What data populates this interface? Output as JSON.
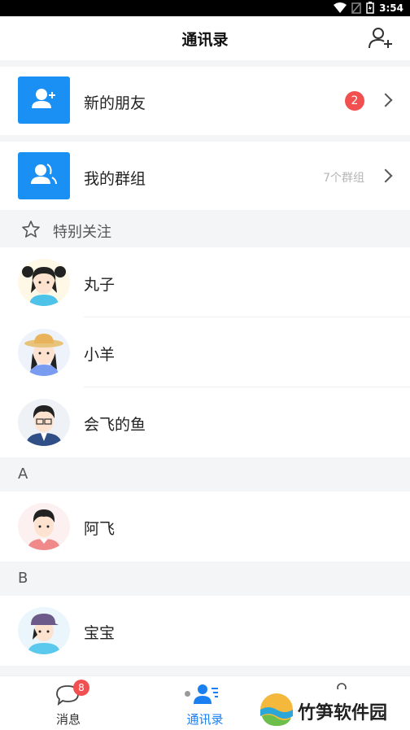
{
  "status": {
    "time": "3:54"
  },
  "header": {
    "title": "通讯录"
  },
  "top_rows": [
    {
      "label": "新的朋友",
      "badge": "2"
    },
    {
      "label": "我的群组",
      "count": "7个群组"
    }
  ],
  "special": {
    "title": "特别关注"
  },
  "special_contacts": [
    "丸子",
    "小羊",
    "会飞的鱼"
  ],
  "groups": [
    {
      "letter": "A",
      "contacts": [
        "阿飞"
      ]
    },
    {
      "letter": "B",
      "contacts": [
        "宝宝"
      ]
    }
  ],
  "tabs": [
    {
      "label": "消息",
      "badge": "8"
    },
    {
      "label": "通讯录"
    }
  ],
  "watermark": {
    "text": "竹笋软件园"
  },
  "colors": {
    "accent": "#1a90f5",
    "badge": "#f25050",
    "active_tab": "#1a7ff0"
  }
}
